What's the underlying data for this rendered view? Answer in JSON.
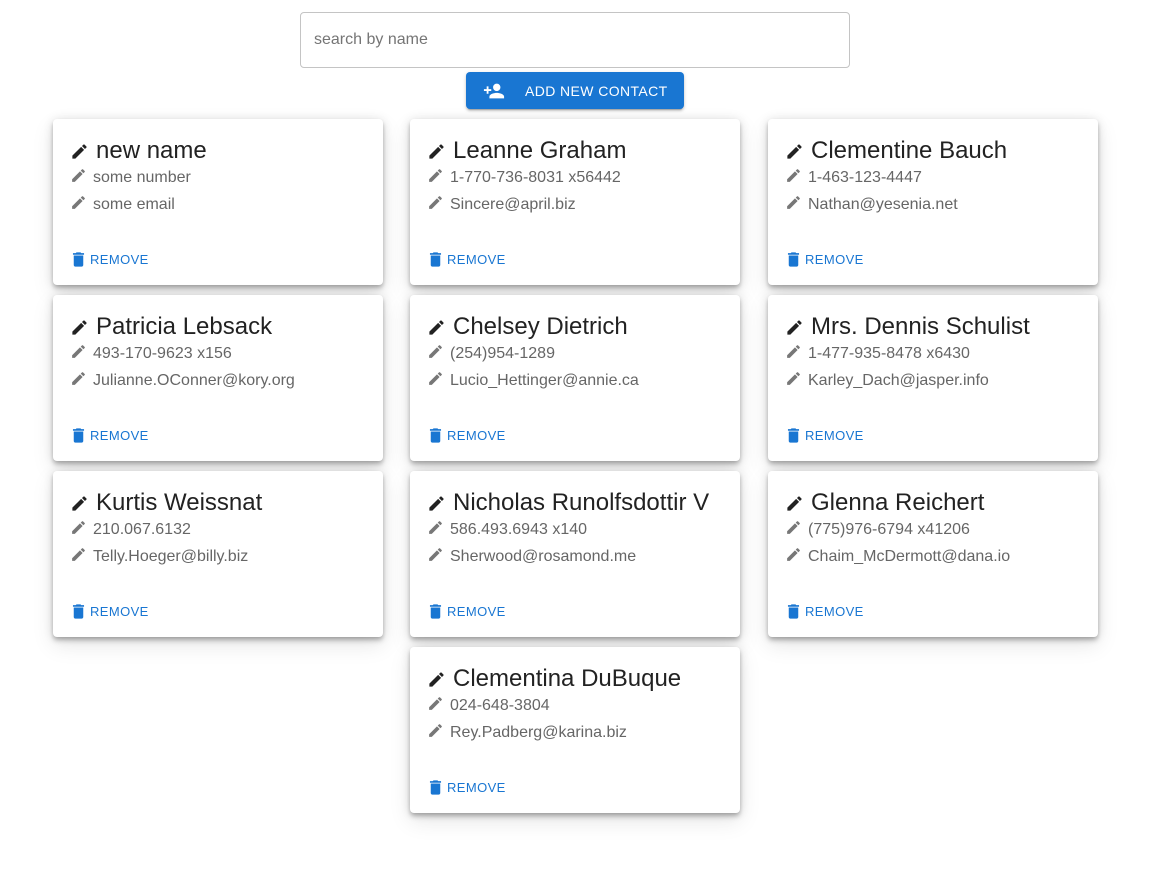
{
  "search": {
    "placeholder": "search by name",
    "value": ""
  },
  "add_button": {
    "label": "ADD NEW CONTACT",
    "icon": "person-add-icon"
  },
  "remove_label": "REMOVE",
  "colors": {
    "primary": "#1976d2",
    "name_text": "#222222",
    "detail_text": "#666666"
  },
  "contacts": [
    {
      "name": "new name",
      "phone": "some number",
      "email": "some email"
    },
    {
      "name": "Leanne Graham",
      "phone": "1-770-736-8031 x56442",
      "email": "Sincere@april.biz"
    },
    {
      "name": "Clementine Bauch",
      "phone": "1-463-123-4447",
      "email": "Nathan@yesenia.net"
    },
    {
      "name": "Patricia Lebsack",
      "phone": "493-170-9623 x156",
      "email": "Julianne.OConner@kory.org"
    },
    {
      "name": "Chelsey Dietrich",
      "phone": "(254)954-1289",
      "email": "Lucio_Hettinger@annie.ca"
    },
    {
      "name": "Mrs. Dennis Schulist",
      "phone": "1-477-935-8478 x6430",
      "email": "Karley_Dach@jasper.info"
    },
    {
      "name": "Kurtis Weissnat",
      "phone": "210.067.6132",
      "email": "Telly.Hoeger@billy.biz"
    },
    {
      "name": "Nicholas Runolfsdottir V",
      "phone": "586.493.6943 x140",
      "email": "Sherwood@rosamond.me"
    },
    {
      "name": "Glenna Reichert",
      "phone": "(775)976-6794 x41206",
      "email": "Chaim_McDermott@dana.io"
    },
    {
      "name": "Clementina DuBuque",
      "phone": "024-648-3804",
      "email": "Rey.Padberg@karina.biz"
    }
  ]
}
